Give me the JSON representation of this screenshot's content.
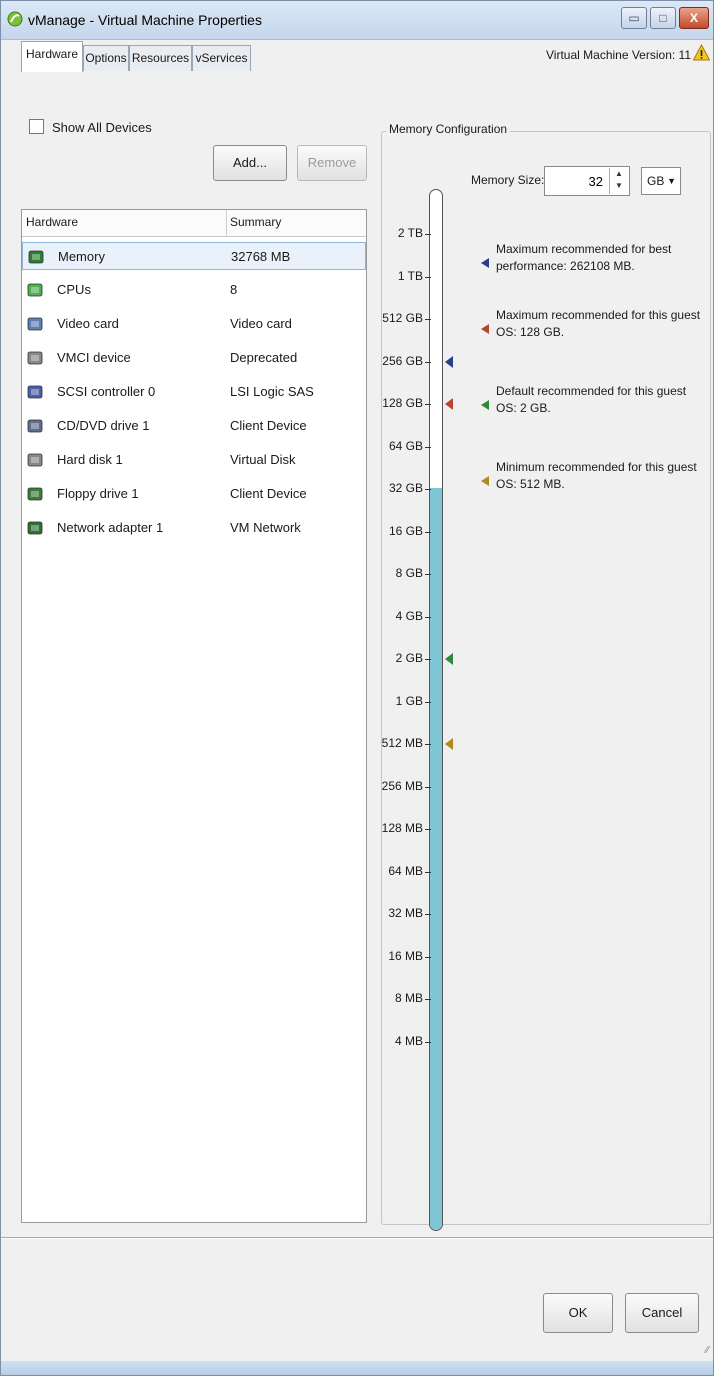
{
  "window": {
    "title": "vManage - Virtual Machine Properties",
    "min_glyph": "▭",
    "max_glyph": "□",
    "close_glyph": "X"
  },
  "tabs": [
    {
      "label": "Hardware",
      "active": true
    },
    {
      "label": "Options",
      "active": false
    },
    {
      "label": "Resources",
      "active": false
    },
    {
      "label": "vServices",
      "active": false
    }
  ],
  "vm_version": "Virtual Machine Version: 11",
  "show_all_devices": {
    "label": "Show All Devices",
    "checked": false
  },
  "buttons": {
    "add": "Add...",
    "remove": "Remove",
    "ok": "OK",
    "cancel": "Cancel"
  },
  "hardware_table": {
    "columns": [
      "Hardware",
      "Summary"
    ],
    "rows": [
      {
        "name": "Memory",
        "summary": "32768 MB",
        "icon": "memory-icon",
        "selected": true
      },
      {
        "name": "CPUs",
        "summary": "8",
        "icon": "cpu-icon",
        "selected": false
      },
      {
        "name": "Video card",
        "summary": "Video card",
        "icon": "video-card-icon",
        "selected": false
      },
      {
        "name": "VMCI device",
        "summary": "Deprecated",
        "icon": "vmci-device-icon",
        "selected": false
      },
      {
        "name": "SCSI controller 0",
        "summary": "LSI Logic SAS",
        "icon": "scsi-controller-icon",
        "selected": false
      },
      {
        "name": "CD/DVD drive 1",
        "summary": "Client Device",
        "icon": "cd-dvd-icon",
        "selected": false
      },
      {
        "name": "Hard disk 1",
        "summary": "Virtual Disk",
        "icon": "hard-disk-icon",
        "selected": false
      },
      {
        "name": "Floppy drive 1",
        "summary": "Client Device",
        "icon": "floppy-icon",
        "selected": false
      },
      {
        "name": "Network adapter 1",
        "summary": "VM Network",
        "icon": "network-adapter-icon",
        "selected": false
      }
    ]
  },
  "memory_config": {
    "legend": "Memory Configuration",
    "size_label": "Memory Size:",
    "size_value": "32",
    "unit": "GB",
    "scale_labels": [
      "2 TB",
      "1 TB",
      "512 GB",
      "256 GB",
      "128 GB",
      "64 GB",
      "32 GB",
      "16 GB",
      "8 GB",
      "4 GB",
      "2 GB",
      "1 GB",
      "512 MB",
      "256 MB",
      "128 MB",
      "64 MB",
      "32 MB",
      "16 MB",
      "8 MB",
      "4 MB"
    ],
    "current_level": "32 GB",
    "markers": [
      {
        "text": "Maximum recommended for best performance: 262108 MB.",
        "color": "#2c3d8c",
        "at": "256 GB"
      },
      {
        "text": "Maximum recommended for this guest OS: 128 GB.",
        "color": "#b9452a",
        "at": "128 GB"
      },
      {
        "text": "Default recommended for this guest OS: 2 GB.",
        "color": "#2f8a3a",
        "at": "2 GB"
      },
      {
        "text": "Minimum recommended for this guest OS: 512 MB.",
        "color": "#b08a1f",
        "at": "512 MB"
      }
    ]
  }
}
